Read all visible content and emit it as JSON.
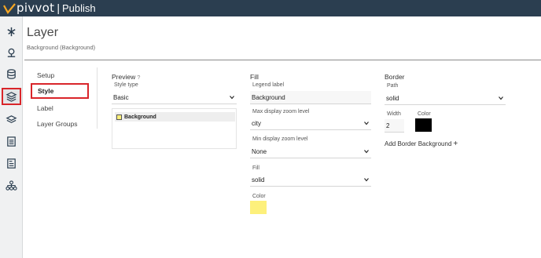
{
  "app": {
    "logo_text": "pivvot",
    "separator": "|",
    "section": "Publish",
    "brand_accent": "#f5a623",
    "topbar_color": "#2b3e50"
  },
  "rail": {
    "items": [
      {
        "name": "route-icon"
      },
      {
        "name": "location-pin-icon"
      },
      {
        "name": "database-icon"
      },
      {
        "name": "layers-icon",
        "active": true
      },
      {
        "name": "layer-stack-icon"
      },
      {
        "name": "document-list-icon"
      },
      {
        "name": "document-icon"
      },
      {
        "name": "hierarchy-icon"
      }
    ]
  },
  "header": {
    "title": "Layer",
    "subtitle": "Background (Background)"
  },
  "subnav": {
    "items": [
      {
        "label": "Setup"
      },
      {
        "label": "Style",
        "active": true
      },
      {
        "label": "Label"
      },
      {
        "label": "Layer Groups"
      }
    ]
  },
  "preview": {
    "heading": "Preview",
    "help": "?",
    "style_type_label": "Style type",
    "style_type_value": "Basic",
    "legend_item": "Background"
  },
  "fill": {
    "heading": "Fill",
    "legend_label": "Legend label",
    "legend_value": "Background",
    "max_zoom_label": "Max display zoom level",
    "max_zoom_value": "city",
    "min_zoom_label": "Min display zoom level",
    "min_zoom_value": "None",
    "fill_label": "Fill",
    "fill_value": "solid",
    "color_label": "Color",
    "color_value": "#fdf07b"
  },
  "border": {
    "heading": "Border",
    "path_label": "Path",
    "path_value": "solid",
    "width_label": "Width",
    "width_value": "2",
    "color_label": "Color",
    "color_value": "#000000",
    "add_label": "Add Border Background",
    "add_icon": "+"
  }
}
